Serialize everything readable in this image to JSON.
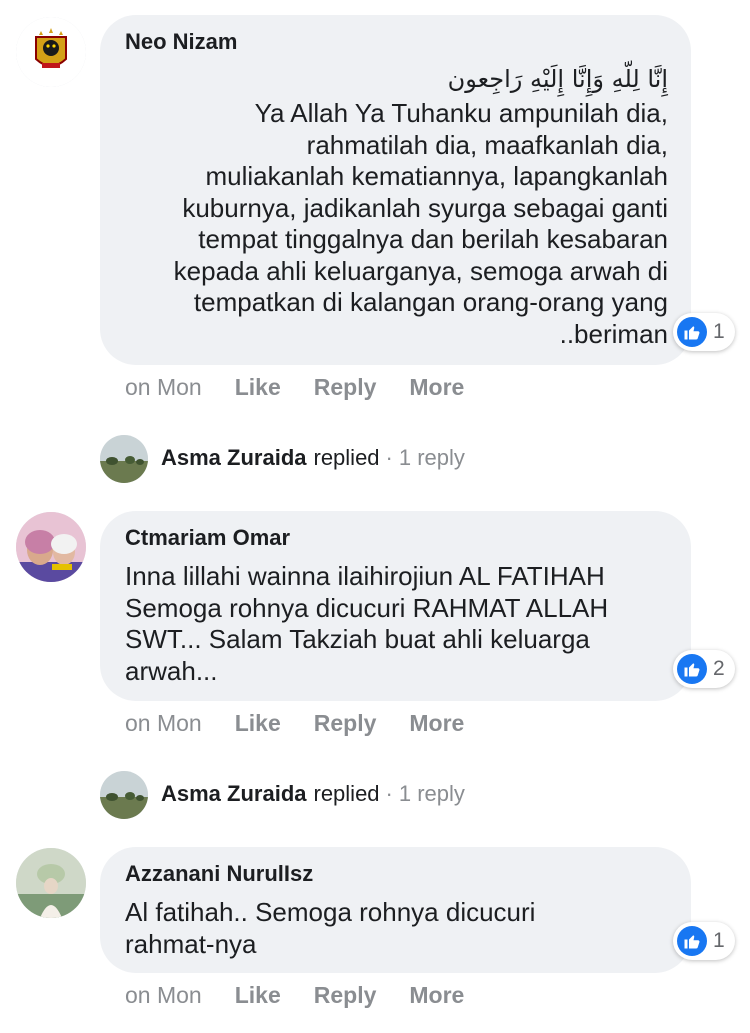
{
  "comments": [
    {
      "author": "Neo Nizam",
      "arabic": "إِنَّا لِلّهِ وَإِنَّا إِلَيْهِ رَاجِعون",
      "text": "Ya Allah Ya Tuhanku ampunilah dia,\nrahmatilah dia, maafkanlah dia,\nmuliakanlah kematiannya, lapangkanlah\nkuburnya, jadikanlah syurga sebagai ganti\ntempat tinggalnya dan berilah kesabaran\nkepada ahli keluarganya, semoga arwah di\ntempatkan di kalangan orang-orang yang\n..beriman",
      "reaction_count": "1",
      "time": "on Mon",
      "like": "Like",
      "reply": "Reply",
      "more": "More",
      "replied": {
        "name": "Asma Zuraida",
        "word": "replied",
        "dot": "·",
        "count": "1 reply"
      }
    },
    {
      "author": "Ctmariam Omar",
      "text": "Inna lillahi wainna ilaihirojiun AL FATIHAH\nSemoga rohnya dicucuri RAHMAT ALLAH\nSWT... Salam Takziah buat ahli keluarga\narwah...",
      "reaction_count": "2",
      "time": "on Mon",
      "like": "Like",
      "reply": "Reply",
      "more": "More",
      "replied": {
        "name": "Asma Zuraida",
        "word": "replied",
        "dot": "·",
        "count": "1 reply"
      }
    },
    {
      "author": "Azzanani NurulIsz",
      "text": "Al fatihah.. Semoga rohnya dicucuri\nrahmat-nya",
      "reaction_count": "1",
      "time": "on Mon",
      "like": "Like",
      "reply": "Reply",
      "more": "More"
    }
  ],
  "colors": {
    "bubble": "#eff1f4",
    "like_blue": "#1877f2",
    "muted": "#8a8d91"
  }
}
